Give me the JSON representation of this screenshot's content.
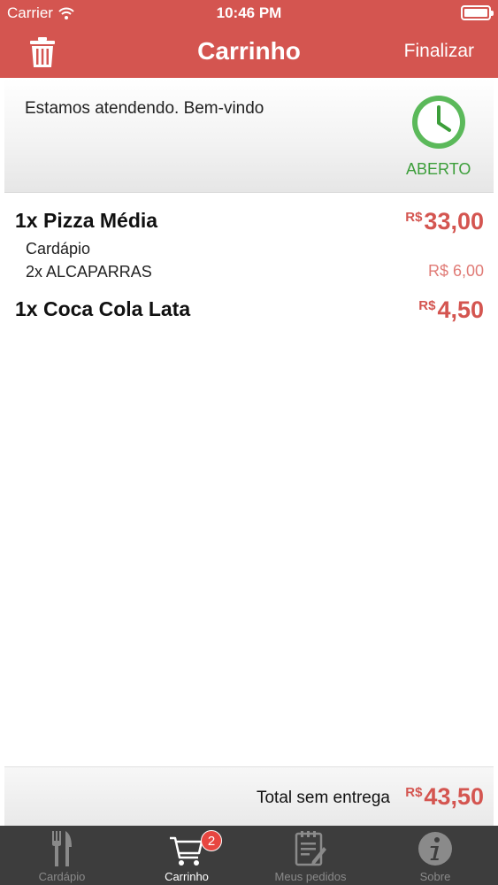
{
  "status_bar": {
    "carrier": "Carrier",
    "time": "10:46 PM"
  },
  "nav": {
    "title": "Carrinho",
    "finalize_label": "Finalizar",
    "trash_icon": "trash-icon"
  },
  "info": {
    "message": "Estamos atendendo. Bem-vindo",
    "status": "ABERTO",
    "status_color": "#3c9e3a"
  },
  "items": [
    {
      "name": "1x Pizza Média",
      "currency": "R$",
      "price": "33,00",
      "details": [
        {
          "text": "Cardápio",
          "price": ""
        },
        {
          "text": "2x ALCAPARRAS",
          "price": "R$ 6,00"
        }
      ]
    },
    {
      "name": "1x Coca Cola Lata",
      "currency": "R$",
      "price": "4,50"
    }
  ],
  "total": {
    "label": "Total sem entrega",
    "currency": "R$",
    "value": "43,50"
  },
  "tabs": [
    {
      "label": "Cardápio",
      "icon": "fork-knife-icon",
      "active": false
    },
    {
      "label": "Carrinho",
      "icon": "cart-icon",
      "active": true,
      "badge": "2"
    },
    {
      "label": "Meus pedidos",
      "icon": "order-list-icon",
      "active": false
    },
    {
      "label": "Sobre",
      "icon": "info-icon",
      "active": false
    }
  ],
  "colors": {
    "accent": "#d45550",
    "price": "#d45550",
    "tabbar": "#3d3d3d",
    "badge": "#e74640"
  }
}
